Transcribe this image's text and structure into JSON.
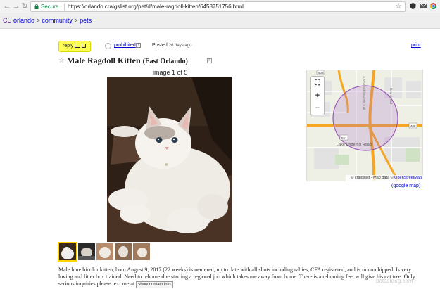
{
  "browser": {
    "secure_label": "Secure",
    "url": "https://orlando.craigslist.org/pet/d/male-ragdoll-kitten/6458751756.html"
  },
  "breadcrumb": {
    "logo": "CL",
    "items": [
      "orlando",
      "community",
      "pets"
    ],
    "separator": ">"
  },
  "posting": {
    "reply_label": "reply",
    "prohibited_label": "prohibited",
    "posted_label": "Posted",
    "posted_ago": "26 days ago",
    "print_label": "print",
    "title": "Male Ragdoll Kitten",
    "location": "(East Orlando)",
    "image_counter": "image 1 of 5",
    "body": "Male blue bicolor kitten, born August 9, 2017 (22 weeks) is neutered, up to date with all shots including rabies, CFA registered, and is microchipped. Is very loving and litter box trained. Need to rehome due starting a regional job which takes me away from home. There is a rehoming fee, will give his cat tree. Only serious inquiries please text me at",
    "show_contact_label": "show contact info"
  },
  "map": {
    "street_label": "Lake Underhill Road",
    "road_label_1": "S Econlockhatchee Trail",
    "road_label_2": "Dean Road",
    "shield_1": "408",
    "shield_2": "408",
    "shield_3": "551",
    "attribution_prefix": "© craigslist - Map data ©",
    "attribution_link": "OpenStreetMap",
    "google_map_label": "(google map)",
    "zoom_in": "+",
    "zoom_out": "−",
    "fullscreen": "⛶"
  },
  "watermark": "petcatdog.com",
  "colors": {
    "reply_bg": "#ffff53",
    "link": "#0000cc",
    "map_road": "#f5a623",
    "map_circle": "#9b59b6"
  }
}
